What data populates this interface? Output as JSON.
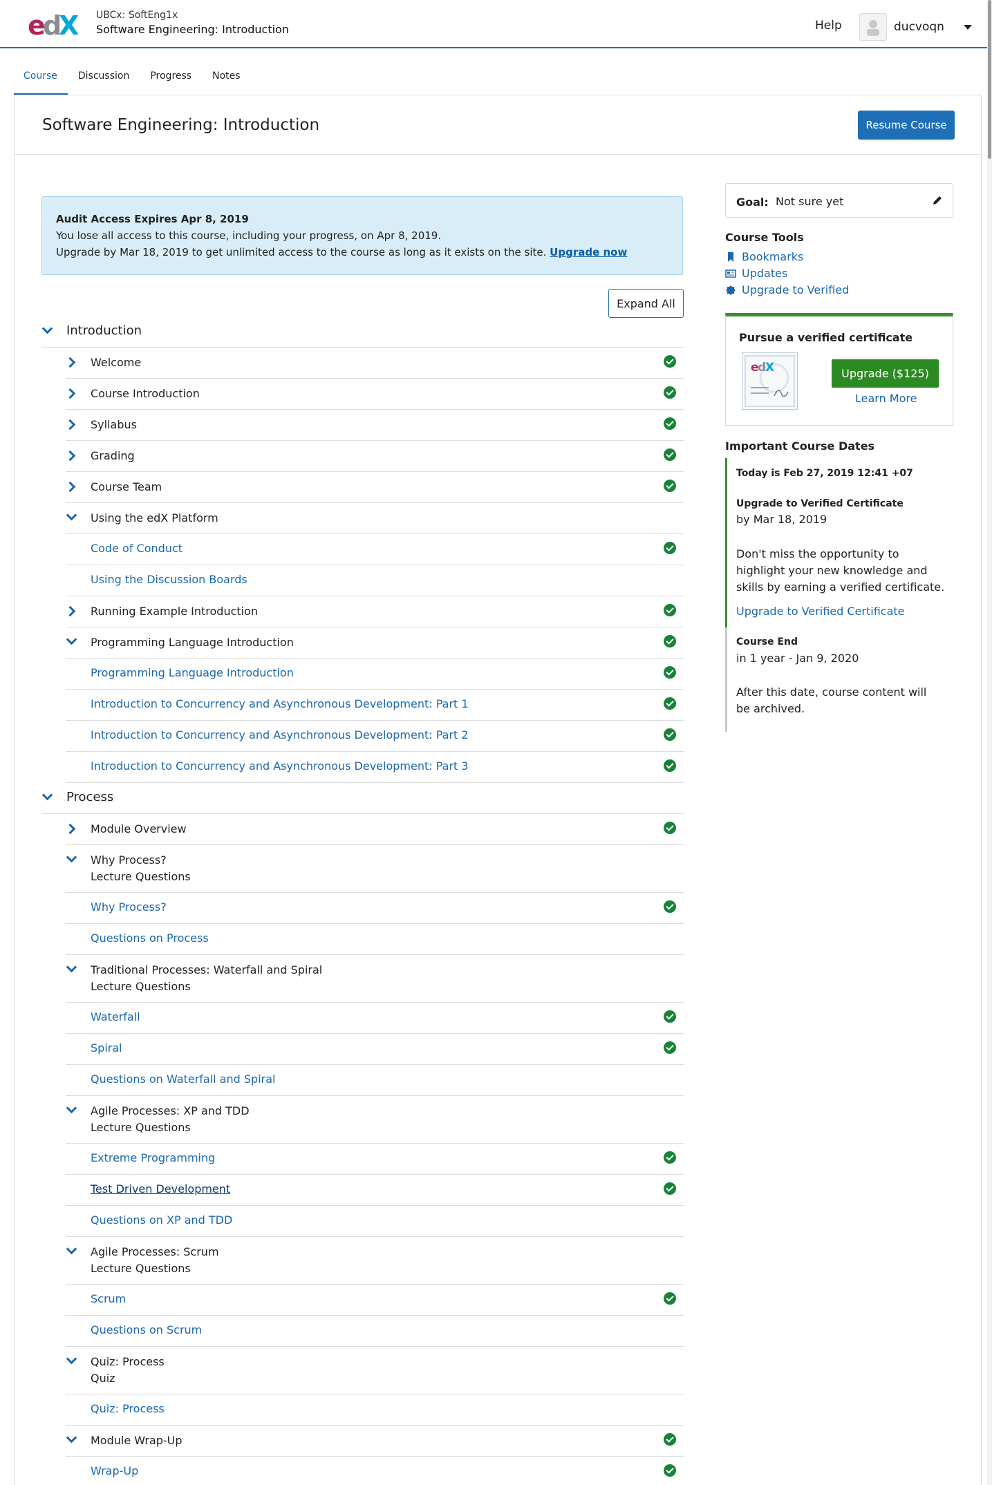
{
  "header": {
    "org_course": "UBCx: SoftEng1x",
    "course_title": "Software Engineering: Introduction",
    "help": "Help",
    "username": "ducvoqn"
  },
  "tabs": [
    {
      "label": "Course",
      "active": true
    },
    {
      "label": "Discussion",
      "active": false
    },
    {
      "label": "Progress",
      "active": false
    },
    {
      "label": "Notes",
      "active": false
    }
  ],
  "page": {
    "title": "Software Engineering: Introduction",
    "resume_button": "Resume Course"
  },
  "banner": {
    "title": "Audit Access Expires Apr 8, 2019",
    "line1": "You lose all access to this course, including your progress, on Apr 8, 2019.",
    "line2": "Upgrade by Mar 18, 2019 to get unlimited access to the course as long as it exists on the site.",
    "link": "Upgrade now"
  },
  "expand_all": "Expand All",
  "outline": [
    {
      "kind": "section",
      "label": "Introduction",
      "expanded": true
    },
    {
      "kind": "sub",
      "label": "Welcome",
      "expanded": false,
      "done": true
    },
    {
      "kind": "sub",
      "label": "Course Introduction",
      "expanded": false,
      "done": true
    },
    {
      "kind": "sub",
      "label": "Syllabus",
      "expanded": false,
      "done": true
    },
    {
      "kind": "sub",
      "label": "Grading",
      "expanded": false,
      "done": true
    },
    {
      "kind": "sub",
      "label": "Course Team",
      "expanded": false,
      "done": true
    },
    {
      "kind": "sub",
      "label": "Using the edX Platform",
      "expanded": true,
      "done": false
    },
    {
      "kind": "unit",
      "label": "Code of Conduct",
      "done": true
    },
    {
      "kind": "unit",
      "label": "Using the Discussion Boards",
      "done": false
    },
    {
      "kind": "sub",
      "label": "Running Example Introduction",
      "expanded": false,
      "done": true
    },
    {
      "kind": "sub",
      "label": "Programming Language Introduction",
      "expanded": true,
      "done": true
    },
    {
      "kind": "unit",
      "label": "Programming Language Introduction",
      "done": true
    },
    {
      "kind": "unit",
      "label": "Introduction to Concurrency and Asynchronous Development: Part 1",
      "done": true
    },
    {
      "kind": "unit",
      "label": "Introduction to Concurrency and Asynchronous Development: Part 2",
      "done": true
    },
    {
      "kind": "unit",
      "label": "Introduction to Concurrency and Asynchronous Development: Part 3",
      "done": true
    },
    {
      "kind": "section",
      "label": "Process",
      "expanded": true
    },
    {
      "kind": "sub",
      "label": "Module Overview",
      "expanded": false,
      "done": true
    },
    {
      "kind": "sub",
      "label": "Why Process?",
      "label2": "Lecture Questions",
      "expanded": true,
      "done": false
    },
    {
      "kind": "unit",
      "label": "Why Process?",
      "done": true
    },
    {
      "kind": "unit",
      "label": "Questions on Process",
      "done": false
    },
    {
      "kind": "sub",
      "label": "Traditional Processes: Waterfall and Spiral",
      "label2": "Lecture Questions",
      "expanded": true,
      "done": false
    },
    {
      "kind": "unit",
      "label": "Waterfall",
      "done": true
    },
    {
      "kind": "unit",
      "label": "Spiral",
      "done": true
    },
    {
      "kind": "unit",
      "label": "Questions on Waterfall and Spiral",
      "done": false
    },
    {
      "kind": "sub",
      "label": "Agile Processes: XP and TDD",
      "label2": "Lecture Questions",
      "expanded": true,
      "done": false
    },
    {
      "kind": "unit",
      "label": "Extreme Programming",
      "done": true
    },
    {
      "kind": "unit",
      "label": "Test Driven Development",
      "done": true,
      "underline": true
    },
    {
      "kind": "unit",
      "label": "Questions on XP and TDD",
      "done": false
    },
    {
      "kind": "sub",
      "label": "Agile Processes: Scrum",
      "label2": "Lecture Questions",
      "expanded": true,
      "done": false
    },
    {
      "kind": "unit",
      "label": "Scrum",
      "done": true
    },
    {
      "kind": "unit",
      "label": "Questions on Scrum",
      "done": false
    },
    {
      "kind": "sub",
      "label": "Quiz: Process",
      "label2": "Quiz",
      "expanded": true,
      "done": false
    },
    {
      "kind": "unit",
      "label": "Quiz: Process",
      "done": false
    },
    {
      "kind": "sub",
      "label": "Module Wrap-Up",
      "expanded": true,
      "done": true
    },
    {
      "kind": "unit",
      "label": "Wrap-Up",
      "done": true
    }
  ],
  "sidebar": {
    "goal_label": "Goal:",
    "goal_value": "Not sure yet",
    "tools_heading": "Course Tools",
    "tools": [
      {
        "label": "Bookmarks",
        "icon": "bookmark-icon"
      },
      {
        "label": "Updates",
        "icon": "newspaper-icon"
      },
      {
        "label": "Upgrade to Verified",
        "icon": "badge-icon"
      }
    ],
    "cert_title": "Pursue a verified certificate",
    "upgrade_button": "Upgrade ($125)",
    "learn_more": "Learn More",
    "dates_heading": "Important Course Dates",
    "today": "Today is Feb 27, 2019 12:41 +07",
    "upgrade_title": "Upgrade to Verified Certificate",
    "upgrade_by": "by Mar 18, 2019",
    "upgrade_desc": "Don't miss the opportunity to highlight your new knowledge and skills by earning a verified certificate.",
    "upgrade_link": "Upgrade to Verified Certificate",
    "end_title": "Course End",
    "end_when": "in 1 year - Jan 9, 2020",
    "end_desc": "After this date, course content will be archived."
  },
  "colors": {
    "link": "#1a67ad",
    "primary_button": "#1f6fb6",
    "success": "#17833a",
    "upgrade_green": "#2c8a23",
    "banner_bg": "#d8edf8"
  }
}
